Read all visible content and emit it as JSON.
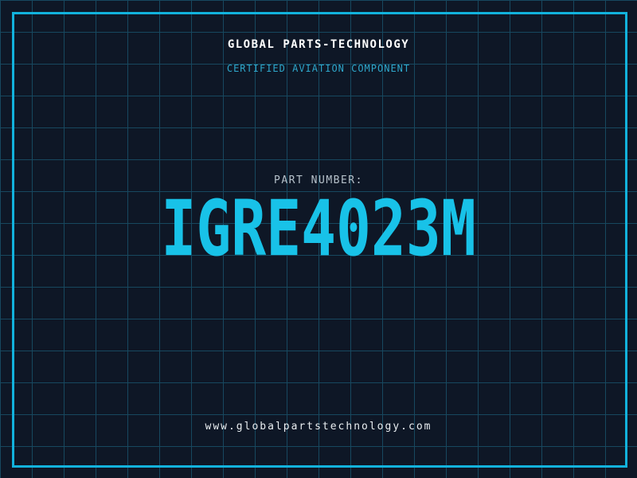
{
  "brand": {
    "title": "GLOBAL PARTS-TECHNOLOGY",
    "subtitle": "CERTIFIED AVIATION COMPONENT"
  },
  "part": {
    "label": "PART NUMBER:",
    "number": "IGRE4023M"
  },
  "footer": {
    "website": "www.globalpartstechnology.com"
  },
  "colors": {
    "background": "#0e1726",
    "grid_line": "#17485f",
    "frame_border": "#12b2dc",
    "part_number_cyan": "#18c2e8",
    "subtitle_cyan": "#2ea7cb",
    "label_gray": "#b6c1ca",
    "title_white": "#ffffff",
    "website_white": "#e9eef1"
  }
}
